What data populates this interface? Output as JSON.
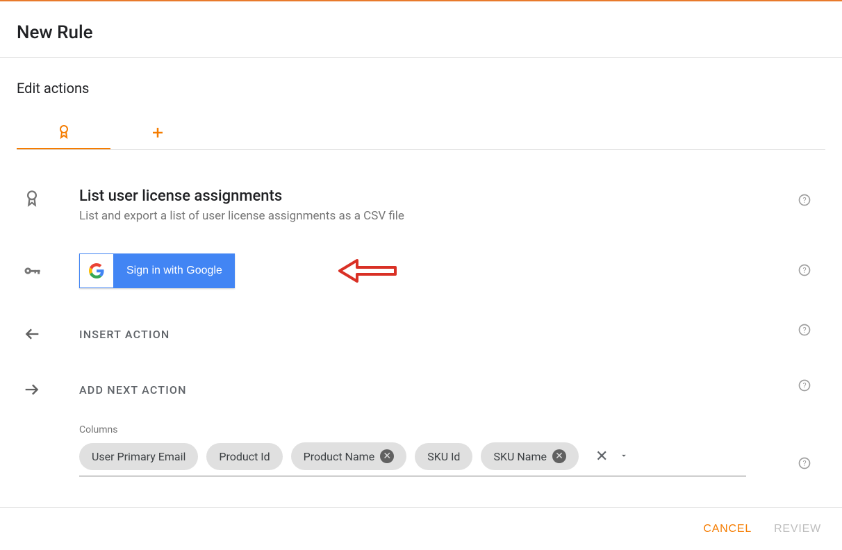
{
  "header": {
    "title": "New Rule"
  },
  "section": {
    "title": "Edit actions"
  },
  "action": {
    "title": "List user license assignments",
    "description": "List and export a list of user license assignments as a CSV file"
  },
  "signin": {
    "label": "Sign in with Google"
  },
  "insert": {
    "label": "INSERT ACTION"
  },
  "addnext": {
    "label": "ADD NEXT ACTION"
  },
  "columns": {
    "label": "Columns",
    "chips": [
      {
        "label": "User Primary Email",
        "deletable": false
      },
      {
        "label": "Product Id",
        "deletable": false
      },
      {
        "label": "Product Name",
        "deletable": true
      },
      {
        "label": "SKU Id",
        "deletable": false
      },
      {
        "label": "SKU Name",
        "deletable": true
      }
    ]
  },
  "footer": {
    "cancel": "CANCEL",
    "review": "REVIEW"
  },
  "colors": {
    "accent": "#f57c00",
    "google_blue": "#4285f4"
  }
}
